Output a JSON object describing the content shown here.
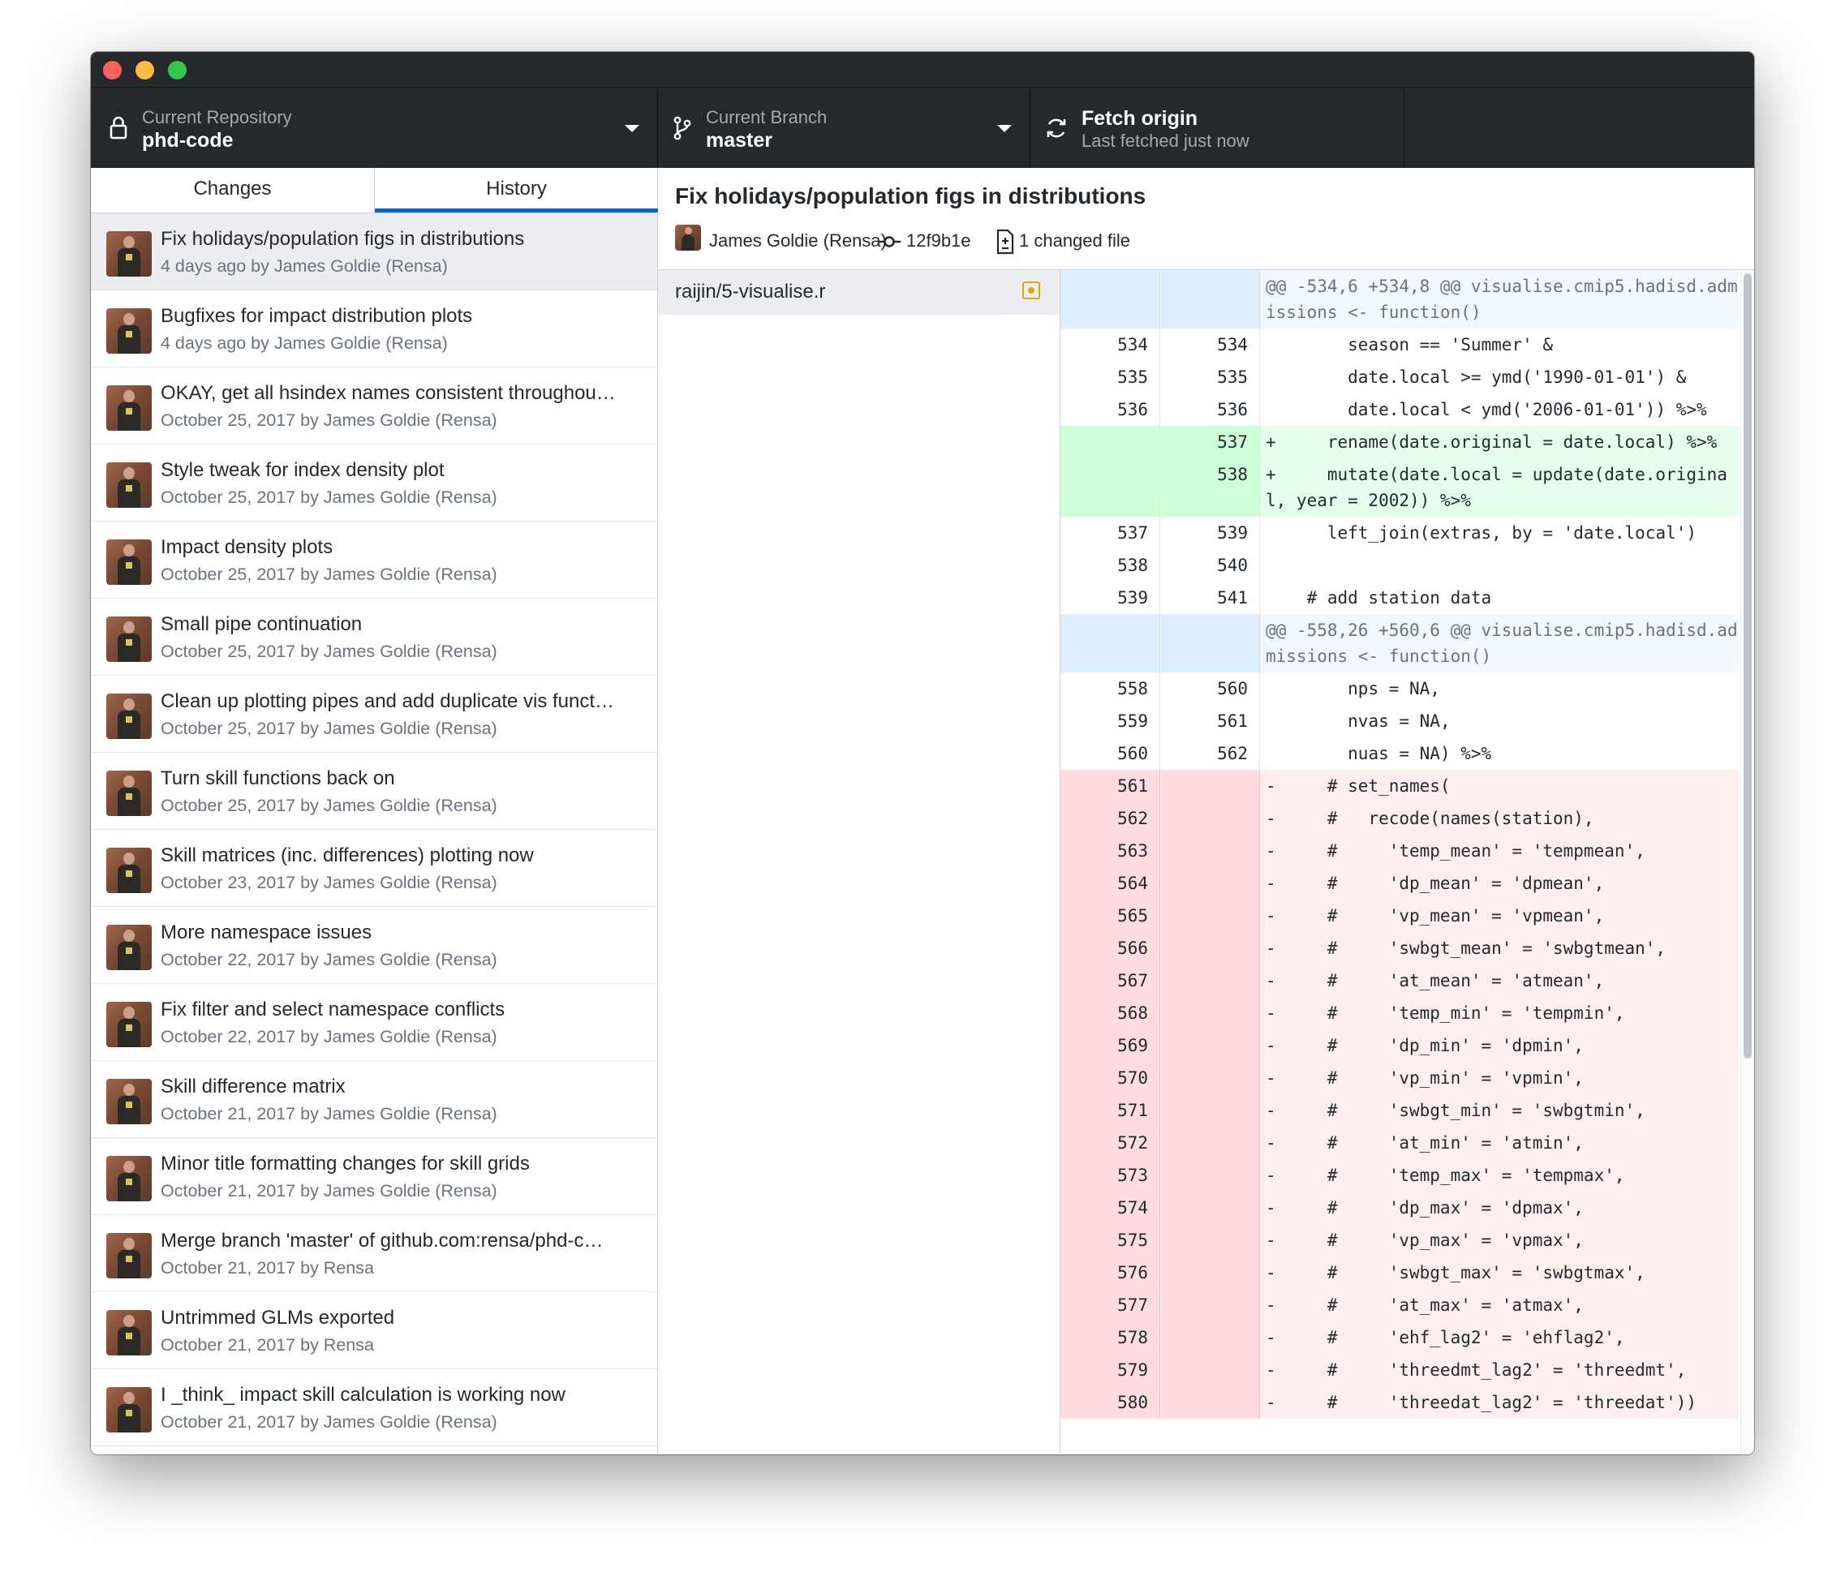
{
  "toolbar": {
    "repository": {
      "label": "Current Repository",
      "value": "phd-code"
    },
    "branch": {
      "label": "Current Branch",
      "value": "master"
    },
    "fetch": {
      "title": "Fetch origin",
      "subtitle": "Last fetched just now"
    }
  },
  "tabs": {
    "changes": "Changes",
    "history": "History"
  },
  "commits": [
    {
      "title": "Fix holidays/population figs in distributions",
      "meta": "4 days ago by James Goldie (Rensa)"
    },
    {
      "title": "Bugfixes for impact distribution plots",
      "meta": "4 days ago by James Goldie (Rensa)"
    },
    {
      "title": "OKAY, get all hsindex names consistent throughou…",
      "meta": "October 25, 2017 by James Goldie (Rensa)"
    },
    {
      "title": "Style tweak for index density plot",
      "meta": "October 25, 2017 by James Goldie (Rensa)"
    },
    {
      "title": "Impact density plots",
      "meta": "October 25, 2017 by James Goldie (Rensa)"
    },
    {
      "title": "Small pipe continuation",
      "meta": "October 25, 2017 by James Goldie (Rensa)"
    },
    {
      "title": "Clean up plotting pipes and add duplicate vis funct…",
      "meta": "October 25, 2017 by James Goldie (Rensa)"
    },
    {
      "title": "Turn skill functions back on",
      "meta": "October 25, 2017 by James Goldie (Rensa)"
    },
    {
      "title": "Skill matrices (inc. differences) plotting now",
      "meta": "October 23, 2017 by James Goldie (Rensa)"
    },
    {
      "title": "More namespace issues",
      "meta": "October 22, 2017 by James Goldie (Rensa)"
    },
    {
      "title": "Fix filter and select namespace conflicts",
      "meta": "October 22, 2017 by James Goldie (Rensa)"
    },
    {
      "title": "Skill difference matrix",
      "meta": "October 21, 2017 by James Goldie (Rensa)"
    },
    {
      "title": "Minor title formatting changes for skill grids",
      "meta": "October 21, 2017 by James Goldie (Rensa)"
    },
    {
      "title": "Merge branch 'master' of github.com:rensa/phd-c…",
      "meta": "October 21, 2017 by Rensa"
    },
    {
      "title": "Untrimmed GLMs exported",
      "meta": "October 21, 2017 by Rensa"
    },
    {
      "title": "I _think_ impact skill calculation is working now",
      "meta": "October 21, 2017 by James Goldie (Rensa)"
    }
  ],
  "commit_header": {
    "title": "Fix holidays/population figs in distributions",
    "author": "James Goldie (Rensa)",
    "sha": "12f9b1e",
    "changed_files": "1 changed file"
  },
  "files": [
    {
      "name": "raijin/5-visualise.r",
      "status": "modified"
    }
  ],
  "diff": [
    {
      "t": "hunk",
      "o": "",
      "n": "",
      "c": "@@ -534,6 +534,8 @@ visualise.cmip5.hadisd.admissions <- function()"
    },
    {
      "t": "ctx",
      "o": "534",
      "n": "534",
      "c": "        season == 'Summer' &"
    },
    {
      "t": "ctx",
      "o": "535",
      "n": "535",
      "c": "        date.local >= ymd('1990-01-01') &"
    },
    {
      "t": "ctx",
      "o": "536",
      "n": "536",
      "c": "        date.local < ymd('2006-01-01')) %>%"
    },
    {
      "t": "add",
      "o": "",
      "n": "537",
      "c": "+     rename(date.original = date.local) %>%"
    },
    {
      "t": "add",
      "o": "",
      "n": "538",
      "c": "+     mutate(date.local = update(date.original, year = 2002)) %>%"
    },
    {
      "t": "ctx",
      "o": "537",
      "n": "539",
      "c": "      left_join(extras, by = 'date.local')"
    },
    {
      "t": "ctx",
      "o": "538",
      "n": "540",
      "c": ""
    },
    {
      "t": "ctx",
      "o": "539",
      "n": "541",
      "c": "    # add station data"
    },
    {
      "t": "hunk",
      "o": "",
      "n": "",
      "c": "@@ -558,26 +560,6 @@ visualise.cmip5.hadisd.admissions <- function()"
    },
    {
      "t": "ctx",
      "o": "558",
      "n": "560",
      "c": "        nps = NA,"
    },
    {
      "t": "ctx",
      "o": "559",
      "n": "561",
      "c": "        nvas = NA,"
    },
    {
      "t": "ctx",
      "o": "560",
      "n": "562",
      "c": "        nuas = NA) %>%"
    },
    {
      "t": "del",
      "o": "561",
      "n": "",
      "c": "-     # set_names("
    },
    {
      "t": "del",
      "o": "562",
      "n": "",
      "c": "-     #   recode(names(station),"
    },
    {
      "t": "del",
      "o": "563",
      "n": "",
      "c": "-     #     'temp_mean' = 'tempmean',"
    },
    {
      "t": "del",
      "o": "564",
      "n": "",
      "c": "-     #     'dp_mean' = 'dpmean',"
    },
    {
      "t": "del",
      "o": "565",
      "n": "",
      "c": "-     #     'vp_mean' = 'vpmean',"
    },
    {
      "t": "del",
      "o": "566",
      "n": "",
      "c": "-     #     'swbgt_mean' = 'swbgtmean',"
    },
    {
      "t": "del",
      "o": "567",
      "n": "",
      "c": "-     #     'at_mean' = 'atmean',"
    },
    {
      "t": "del",
      "o": "568",
      "n": "",
      "c": "-     #     'temp_min' = 'tempmin',"
    },
    {
      "t": "del",
      "o": "569",
      "n": "",
      "c": "-     #     'dp_min' = 'dpmin',"
    },
    {
      "t": "del",
      "o": "570",
      "n": "",
      "c": "-     #     'vp_min' = 'vpmin',"
    },
    {
      "t": "del",
      "o": "571",
      "n": "",
      "c": "-     #     'swbgt_min' = 'swbgtmin',"
    },
    {
      "t": "del",
      "o": "572",
      "n": "",
      "c": "-     #     'at_min' = 'atmin',"
    },
    {
      "t": "del",
      "o": "573",
      "n": "",
      "c": "-     #     'temp_max' = 'tempmax',"
    },
    {
      "t": "del",
      "o": "574",
      "n": "",
      "c": "-     #     'dp_max' = 'dpmax',"
    },
    {
      "t": "del",
      "o": "575",
      "n": "",
      "c": "-     #     'vp_max' = 'vpmax',"
    },
    {
      "t": "del",
      "o": "576",
      "n": "",
      "c": "-     #     'swbgt_max' = 'swbgtmax',"
    },
    {
      "t": "del",
      "o": "577",
      "n": "",
      "c": "-     #     'at_max' = 'atmax',"
    },
    {
      "t": "del",
      "o": "578",
      "n": "",
      "c": "-     #     'ehf_lag2' = 'ehflag2',"
    },
    {
      "t": "del",
      "o": "579",
      "n": "",
      "c": "-     #     'threedmt_lag2' = 'threedmt',"
    },
    {
      "t": "del",
      "o": "580",
      "n": "",
      "c": "-     #     'threedat_lag2' = 'threedat'))"
    }
  ],
  "colors": {
    "toolbar_bg": "#24292e",
    "accent": "#0366d6",
    "added_bg": "#e6ffed",
    "removed_bg": "#ffeef0",
    "hunk_bg": "#f1f8ff",
    "modified_icon": "#dbab09",
    "traffic_red": "#fc605c",
    "traffic_yellow": "#fdbc40",
    "traffic_green": "#34c84a"
  },
  "icons": [
    "lock-icon",
    "branch-icon",
    "sync-icon",
    "commit-icon",
    "file-diff-icon",
    "file-modified-icon"
  ]
}
